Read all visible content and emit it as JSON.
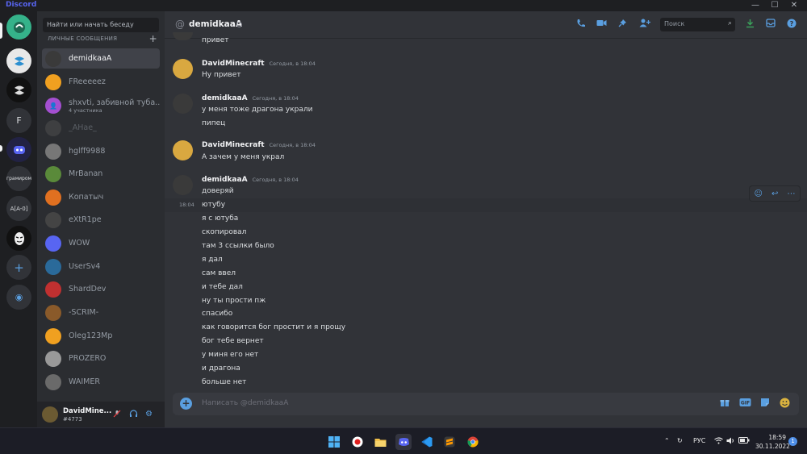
{
  "app": {
    "brand": "Discord"
  },
  "window": {
    "minimize": "—",
    "maximize": "☐",
    "close": "✕"
  },
  "guilds": [
    {
      "label": "",
      "icon": "discord-home-icon",
      "color": "#35b28a"
    },
    {
      "label": "",
      "icon": "server-icon",
      "color": "#e8e8e8"
    },
    {
      "label": "",
      "icon": "server-icon",
      "color": "#111111"
    },
    {
      "label": "F",
      "icon": "",
      "color": "#313338"
    },
    {
      "label": "",
      "icon": "discord-logo-icon",
      "color": "#222244"
    },
    {
      "label": "грамиром",
      "icon": "",
      "color": "#313338"
    },
    {
      "label": "A[A-0]",
      "icon": "",
      "color": "#313338"
    },
    {
      "label": "",
      "icon": "mask-icon",
      "color": "#111111"
    }
  ],
  "add_server": "+",
  "explore": "◉",
  "dm": {
    "search_placeholder": "Найти или начать беседу",
    "header": "ЛИЧНЫЕ СООБЩЕНИЯ",
    "add": "+",
    "items": [
      {
        "name": "demidkaaA",
        "sub": "",
        "color": "#3a3a3a"
      },
      {
        "name": "FReeeeez",
        "sub": "",
        "color": "#f0a020"
      },
      {
        "name": "shxvti, забивной туба...",
        "sub": "4 участника",
        "color": "#a44fd0"
      },
      {
        "name": "_AHae_",
        "sub": "",
        "color": "#555555"
      },
      {
        "name": "hglff9988",
        "sub": "",
        "color": "#777777"
      },
      {
        "name": "MrBanan",
        "sub": "",
        "color": "#5a8a3a"
      },
      {
        "name": "Копатыч",
        "sub": "",
        "color": "#e07020"
      },
      {
        "name": "eXtR1pe",
        "sub": "",
        "color": "#444444"
      },
      {
        "name": "WOW",
        "sub": "",
        "color": "#5865f2"
      },
      {
        "name": "UserSv4",
        "sub": "",
        "color": "#2a6a9a"
      },
      {
        "name": "ShardDev",
        "sub": "",
        "color": "#c03030"
      },
      {
        "name": "-SCRIM-",
        "sub": "",
        "color": "#8a5a2a"
      },
      {
        "name": "Oleg123Mp",
        "sub": "",
        "color": "#f0a020"
      },
      {
        "name": "PROZERO",
        "sub": "",
        "color": "#999999"
      },
      {
        "name": "WAIMER",
        "sub": "",
        "color": "#6a6a6a"
      }
    ]
  },
  "user": {
    "name": "DavidMine...",
    "tag": "#4773"
  },
  "chat": {
    "at": "@",
    "title": "demidkaaA",
    "search_placeholder": "Поиск",
    "composer_placeholder": "Написать @demidkaaA",
    "messages": [
      {
        "author": "",
        "time": "",
        "lines": [
          "привет"
        ]
      },
      {
        "author": "DavidMinecraft",
        "time": "Сегодня, в 18:04",
        "lines": [
          "Ну привет"
        ]
      },
      {
        "author": "demidkaaA",
        "time": "Сегодня, в 18:04",
        "lines": [
          "у меня тоже драгона украли",
          "пипец"
        ]
      },
      {
        "author": "DavidMinecraft",
        "time": "Сегодня, в 18:04",
        "lines": [
          "А зачем у меня украл"
        ]
      },
      {
        "author": "demidkaaA",
        "time": "Сегодня, в 18:04",
        "lines": [
          "доверяй",
          "ютубу",
          "я с ютуба",
          "скопировал",
          "там 3 ссылки было",
          "я дал",
          "сам ввел",
          "и тебе дал",
          "ну ты прости пж",
          "спасибо",
          "как говорится бог простит и я прощу",
          "бог тебе вернет",
          "у миня его нет",
          "и драгона",
          "больше нет"
        ]
      }
    ],
    "hover_time": "18:04"
  },
  "taskbar": {
    "lang": "РУС",
    "time": "18:59",
    "date": "30.11.2022",
    "notifications": "1"
  }
}
